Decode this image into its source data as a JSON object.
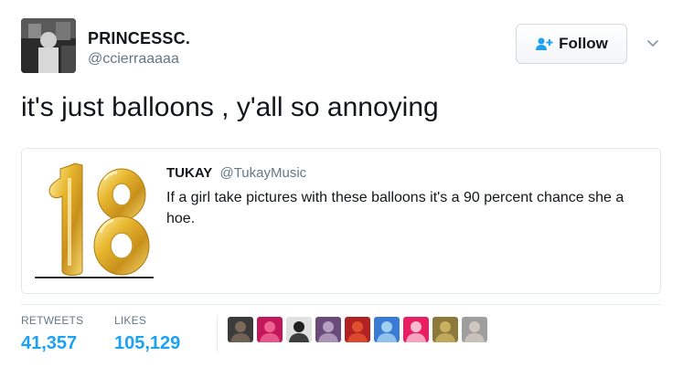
{
  "author": {
    "display_name": "PRINCESSC.",
    "handle": "@ccierraaaaa",
    "avatar_icon": "user-avatar"
  },
  "follow_button": {
    "label": "Follow",
    "icon": "add-user-icon",
    "accent": "#1da1f2"
  },
  "tweet": {
    "text": "it's just balloons , y'all so annoying"
  },
  "quoted_tweet": {
    "author_name": "TUKAY",
    "author_handle": "@TukayMusic",
    "text": "If a girl take pictures with these balloons it's a 90 percent chance she a hoe.",
    "media": "gold-number-18-balloons-image"
  },
  "stats": {
    "retweets_label": "RETWEETS",
    "retweets_count": "41,357",
    "likes_label": "LIKES",
    "likes_count": "105,129"
  },
  "likers": [
    {
      "name": "liker-avatar",
      "color": "#3b3b3b",
      "accent": "#7a6a5a"
    },
    {
      "name": "liker-avatar",
      "color": "#c2185b",
      "accent": "#f06292"
    },
    {
      "name": "liker-avatar",
      "color": "#e0e0e0",
      "accent": "#202020"
    },
    {
      "name": "liker-avatar",
      "color": "#6a4a7a",
      "accent": "#b6a0c2"
    },
    {
      "name": "liker-avatar",
      "color": "#b22222",
      "accent": "#e05030"
    },
    {
      "name": "liker-avatar",
      "color": "#3a7bd5",
      "accent": "#9fd0f0"
    },
    {
      "name": "liker-avatar",
      "color": "#e91e63",
      "accent": "#f8bbd0"
    },
    {
      "name": "liker-avatar",
      "color": "#8d7a3a",
      "accent": "#c8b060"
    },
    {
      "name": "liker-avatar",
      "color": "#9e9e9e",
      "accent": "#d0c8c0"
    }
  ]
}
